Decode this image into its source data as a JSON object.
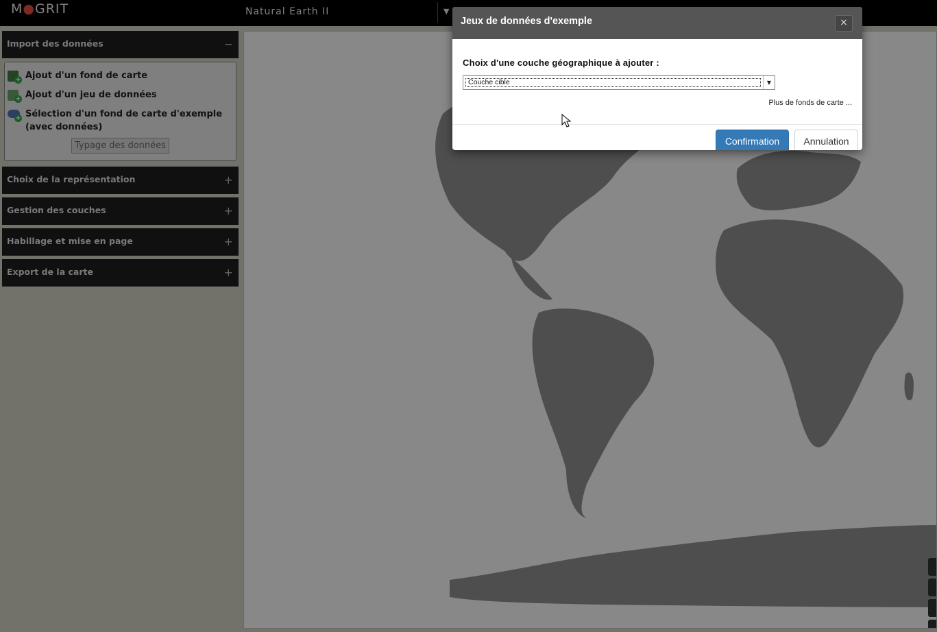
{
  "app": {
    "logo": "MAGRIT",
    "project_name": "Natural Earth II"
  },
  "sidebar": {
    "sections": [
      {
        "title": "Import des données",
        "toggle": "−"
      },
      {
        "title": "Choix de la représentation",
        "toggle": "+"
      },
      {
        "title": "Gestion des couches",
        "toggle": "+"
      },
      {
        "title": "Habillage et mise en page",
        "toggle": "+"
      },
      {
        "title": "Export de la carte",
        "toggle": "+"
      }
    ],
    "import_items": [
      {
        "label": "Ajout d'un fond de carte",
        "icon": "add-basemap-icon"
      },
      {
        "label": "Ajout d'un jeu de données",
        "icon": "add-dataset-icon"
      },
      {
        "label": "Sélection d'un fond de carte d'exemple (avec données)",
        "icon": "cloud-sample-icon"
      }
    ],
    "typage_button": "Typage des données"
  },
  "modal": {
    "title": "Jeux de données d'exemple",
    "close": "×",
    "choice_label": "Choix d'une couche géographique à ajouter :",
    "select_value": "Couche cible",
    "more_link": "Plus de fonds de carte ...",
    "confirm": "Confirmation",
    "cancel": "Annulation"
  },
  "colors": {
    "primary": "#337ab7",
    "overlay": "rgba(0,0,0,0.45)",
    "land": "#8f8f8f"
  }
}
